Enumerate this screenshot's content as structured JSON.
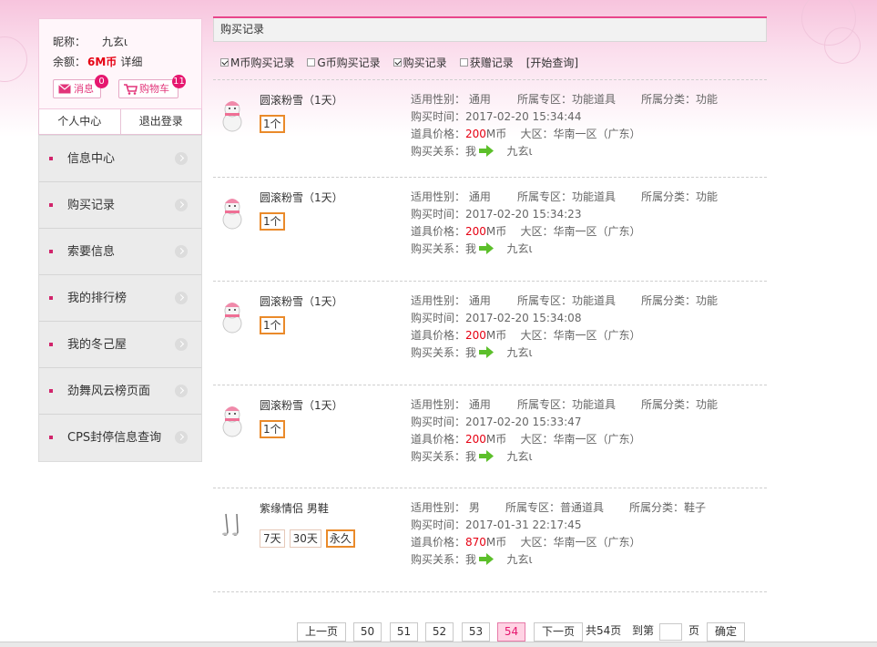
{
  "user": {
    "nick_label": "昵称：",
    "nick": "九玄ι",
    "balance_label": "余额：",
    "balance": "6M币",
    "detail": "详细"
  },
  "quick_buttons": {
    "msg_label": "消息",
    "msg_count": "0",
    "cart_label": "购物车",
    "cart_count": "11"
  },
  "center_tabs": [
    "个人中心",
    "退出登录"
  ],
  "menu": [
    "信息中心",
    "购买记录",
    "索要信息",
    "我的排行榜",
    "我的冬己屋",
    "劲舞风云榜页面",
    "CPS封停信息查询"
  ],
  "section_title": "购买记录",
  "filters": [
    {
      "label": "M币购买记录",
      "checked": true
    },
    {
      "label": "G币购买记录",
      "checked": false
    },
    {
      "label": "购买记录",
      "checked": true
    },
    {
      "label": "获赠记录",
      "checked": false
    }
  ],
  "query_label": "[开始查询]",
  "records": [
    {
      "name": "圆滚粉雪（1天）",
      "chips": [
        "1个"
      ],
      "selected_chip": 0,
      "gender_label": "适用性别：",
      "gender": "通用",
      "zone": "所属专区：功能道具",
      "category": "所属分类：功能",
      "time": "购买时间：2017-02-20 15:34:44",
      "price_label": "道具价格：",
      "price": "200",
      "price_unit": "M币",
      "region": "大区：华南一区（广东）",
      "rel_label": "购买关系：",
      "rel_from": "我",
      "rel_to": "九玄ι",
      "icon": "snowman-icon"
    },
    {
      "name": "圆滚粉雪（1天）",
      "chips": [
        "1个"
      ],
      "selected_chip": 0,
      "gender_label": "适用性别：",
      "gender": "通用",
      "zone": "所属专区：功能道具",
      "category": "所属分类：功能",
      "time": "购买时间：2017-02-20 15:34:23",
      "price_label": "道具价格：",
      "price": "200",
      "price_unit": "M币",
      "region": "大区：华南一区（广东）",
      "rel_label": "购买关系：",
      "rel_from": "我",
      "rel_to": "九玄ι",
      "icon": "snowman-icon"
    },
    {
      "name": "圆滚粉雪（1天）",
      "chips": [
        "1个"
      ],
      "selected_chip": 0,
      "gender_label": "适用性别：",
      "gender": "通用",
      "zone": "所属专区：功能道具",
      "category": "所属分类：功能",
      "time": "购买时间：2017-02-20 15:34:08",
      "price_label": "道具价格：",
      "price": "200",
      "price_unit": "M币",
      "region": "大区：华南一区（广东）",
      "rel_label": "购买关系：",
      "rel_from": "我",
      "rel_to": "九玄ι",
      "icon": "snowman-icon"
    },
    {
      "name": "圆滚粉雪（1天）",
      "chips": [
        "1个"
      ],
      "selected_chip": 0,
      "gender_label": "适用性别：",
      "gender": "通用",
      "zone": "所属专区：功能道具",
      "category": "所属分类：功能",
      "time": "购买时间：2017-02-20 15:33:47",
      "price_label": "道具价格：",
      "price": "200",
      "price_unit": "M币",
      "region": "大区：华南一区（广东）",
      "rel_label": "购买关系：",
      "rel_from": "我",
      "rel_to": "九玄ι",
      "icon": "snowman-icon"
    },
    {
      "name": "紫缘情侣 男鞋",
      "chips": [
        "7天",
        "30天",
        "永久"
      ],
      "selected_chip": 2,
      "gender_label": "适用性别：",
      "gender": "男",
      "zone": "所属专区：普通道具",
      "category": "所属分类：鞋子",
      "time": "购买时间：2017-01-31 22:17:45",
      "price_label": "道具价格：",
      "price": "870",
      "price_unit": "M币",
      "region": "大区：华南一区（广东）",
      "rel_label": "购买关系：",
      "rel_from": "我",
      "rel_to": "九玄ι",
      "icon": "shoes-icon"
    }
  ],
  "pager": {
    "prev": "上一页",
    "pages": [
      "50",
      "51",
      "52",
      "53",
      "54"
    ],
    "current": "54",
    "next": "下一页",
    "total": "共54页",
    "goto_label": "到第",
    "page_unit": "页",
    "confirm": "确定"
  },
  "colors": {
    "accent": "#e8468b",
    "price": "#e60012",
    "chip_selected": "#ea8a2a"
  }
}
